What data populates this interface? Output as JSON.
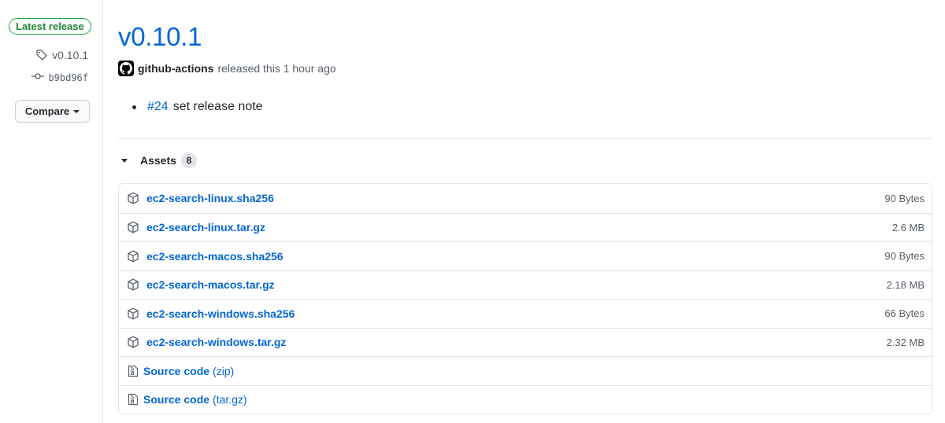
{
  "sidebar": {
    "badge": "Latest release",
    "tag": "v0.10.1",
    "commit": "b9bd96f",
    "compare_label": "Compare"
  },
  "release": {
    "title": "v0.10.1",
    "author": "github-actions",
    "released_text": "released this 1 hour ago",
    "notes": [
      {
        "ref": "#24",
        "text": "set release note"
      }
    ]
  },
  "assets": {
    "label": "Assets",
    "count": "8",
    "items": [
      {
        "name": "ec2-search-linux.sha256",
        "size": "90 Bytes"
      },
      {
        "name": "ec2-search-linux.tar.gz",
        "size": "2.6 MB"
      },
      {
        "name": "ec2-search-macos.sha256",
        "size": "90 Bytes"
      },
      {
        "name": "ec2-search-macos.tar.gz",
        "size": "2.18 MB"
      },
      {
        "name": "ec2-search-windows.sha256",
        "size": "66 Bytes"
      },
      {
        "name": "ec2-search-windows.tar.gz",
        "size": "2.32 MB"
      }
    ],
    "source": [
      {
        "label": "Source code",
        "format": "(zip)"
      },
      {
        "label": "Source code",
        "format": "(tar.gz)"
      }
    ]
  },
  "colors": {
    "link": "#0366d6",
    "badge_green": "#28a745",
    "muted": "#586069",
    "border": "#e1e4e8"
  },
  "icons": {
    "tag": "tag-icon",
    "commit": "git-commit-icon",
    "avatar": "github-mark-icon",
    "asset": "package-icon",
    "source": "file-zip-icon"
  }
}
